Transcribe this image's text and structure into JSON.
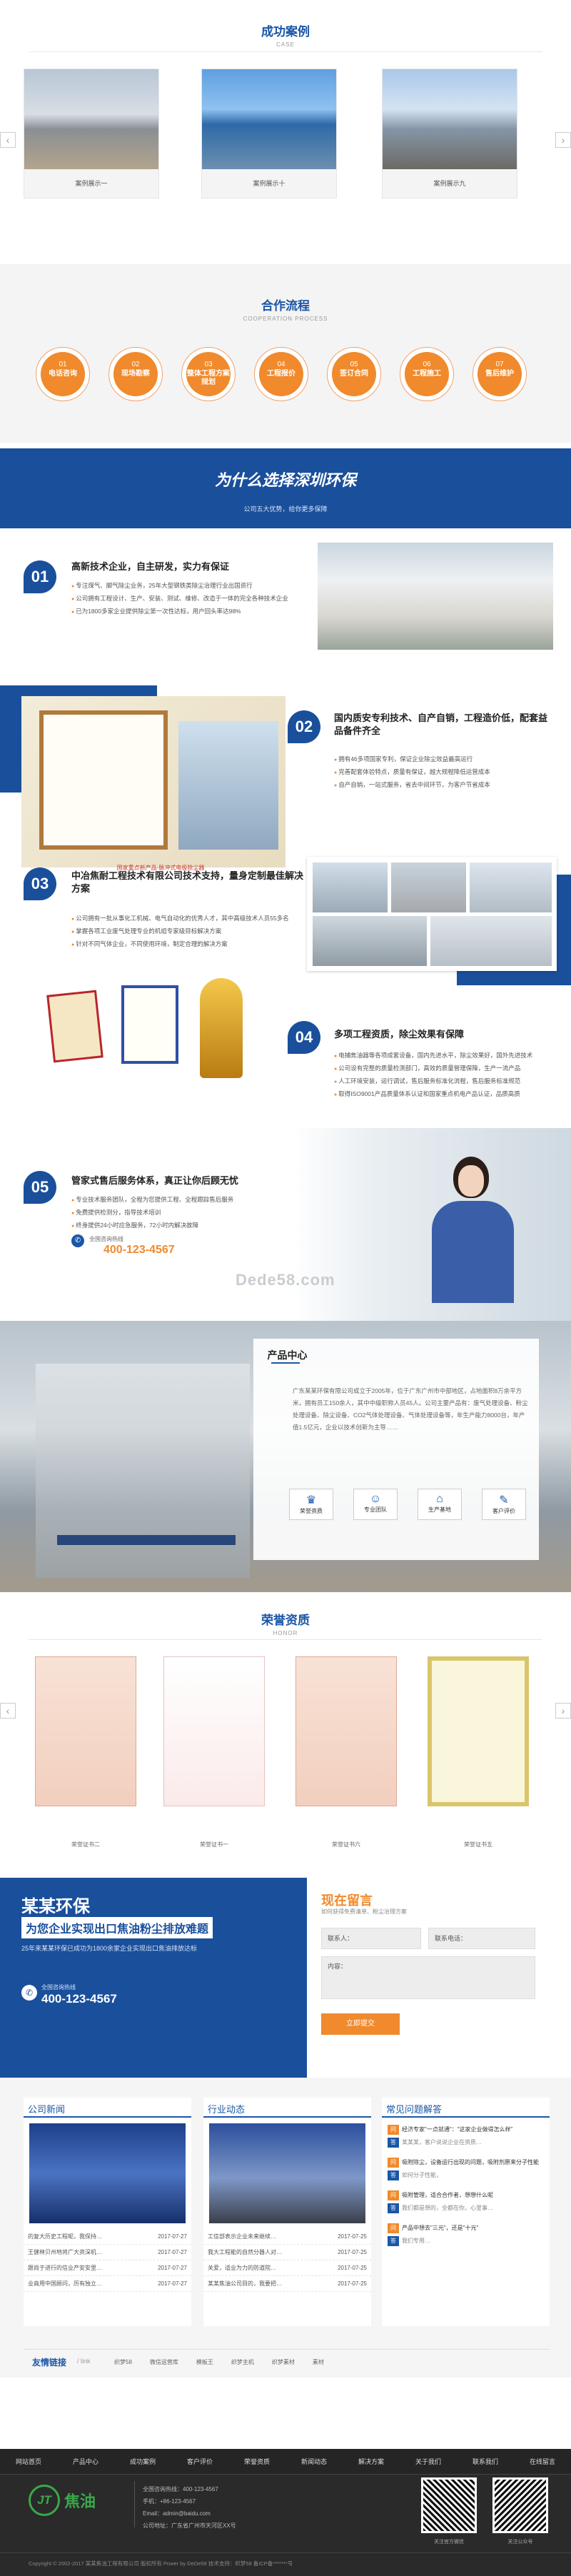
{
  "cases": {
    "title": "成功案例",
    "subtitle": "CASE",
    "items": [
      {
        "caption": "案例展示一"
      },
      {
        "caption": "案例展示十"
      },
      {
        "caption": "案例展示九"
      }
    ],
    "prev_icon": "chevron-left",
    "next_icon": "chevron-right"
  },
  "process": {
    "title": "合作流程",
    "subtitle": "COOPERATION PROCESS",
    "steps": [
      {
        "num": "01",
        "label": "电话咨询"
      },
      {
        "num": "02",
        "label": "现场勘察"
      },
      {
        "num": "03",
        "label": "整体工程方案规划"
      },
      {
        "num": "04",
        "label": "工程报价"
      },
      {
        "num": "05",
        "label": "签订合同"
      },
      {
        "num": "06",
        "label": "工程施工"
      },
      {
        "num": "07",
        "label": "售后维护"
      }
    ]
  },
  "why": {
    "title": "为什么选择深圳环保",
    "subtitle": "公司五大优势，给你更多保障",
    "items": [
      {
        "num": "01",
        "title": "高新技术企业，自主研发，实力有保证",
        "bullets": [
          "专注煤气、脚气除尘业务，25年大型钢铁类除尘治理行业出国资行",
          "公司拥有工程设计、生产、安装、测试、维修、改造于一体的完全各种技术企业",
          "已为1800多家企业提供除尘第一次性达标，用户回头率达98%"
        ]
      },
      {
        "num": "02",
        "title": "国内质安专利技术、自产自销，工程造价低，配套益品备件齐全",
        "bullets": [
          "拥有46多项国家专利，保证企业除尘效益最高运行",
          "完善配套体验特点，质量有保证，越大规程降低运营成本",
          "自产自销，一站式服务，省去中间环节，为客户节省成本"
        ],
        "photo_caption": "国家重点新产品-脉冲式电极除尘器"
      },
      {
        "num": "03",
        "title": "中冶焦耐工程技术有限公司技术支持，量身定制最佳解决方案",
        "bullets": [
          "公司拥有一批从事化工机械、电气自动化的优秀人才，其中高级技术人员55多名",
          "掌握各项工业废气处理专业的机组专家级目标解决方案",
          "针对不同气体企业，不同使用环境，制定合理的解决方案"
        ]
      },
      {
        "num": "04",
        "title": "多项工程资质，除尘效果有保障",
        "bullets": [
          "电捕焦油器等各项成套设备，国内先进水平，除尘效果好，国外先进技术",
          "公司设有完整的质量检测部门，高效的质量管理保障，生产一流产品",
          "人工环境安装，运行调试，售后服务标准化流程，售后服务标准规范",
          "取得ISO9001产品质量体系认证和国家重点机电产品认证，品质高质"
        ]
      },
      {
        "num": "05",
        "title": "管家式售后服务体系，真正让你后顾无忧",
        "bullets": [
          "专业技术服务团队，全程为您提供工程、全程跟踪售后服务",
          "免费提供检测分，指导技术培训",
          "终身提供24小时应急服务，72小时内解决故障"
        ]
      }
    ],
    "hotline_label": "全国咨询热线",
    "hotline": "400-123-4567",
    "watermark": "Dede58.com"
  },
  "product": {
    "title": "产品中心",
    "text": "广东某某环保有限公司成立于2005年，位于广东广州市中部地区，占地面积8万余平方米，拥有员工150余人，其中中级职称人员45人。公司主要产品有：废气处理设备、粉尘处理设备、除尘设备、CO2气体处理设备、气体处理设备等，年生产能力8000台，年产值1.5亿元，企业以技术创新为主导……",
    "tiles": [
      {
        "icon": "honor-icon",
        "label": "荣誉资质"
      },
      {
        "icon": "team-icon",
        "label": "专业团队"
      },
      {
        "icon": "factory-icon",
        "label": "生产基地"
      },
      {
        "icon": "review-icon",
        "label": "客户评价"
      }
    ]
  },
  "honors": {
    "title": "荣誉资质",
    "subtitle": "HONOR",
    "items": [
      {
        "caption": "荣誉证书二"
      },
      {
        "caption": "荣誉证书一"
      },
      {
        "caption": "荣誉证书六"
      },
      {
        "caption": "荣誉证书五"
      }
    ]
  },
  "message": {
    "brand": "某某环保",
    "slogan": "为您企业实现出口焦油粉尘排放难题",
    "desc": "25年来某某环保已成功为1800余家企业实现出口焦油排放达标",
    "hotline_label": "全国咨询热线",
    "hotline": "400-123-4567",
    "form_title": "现在留言",
    "form_sub": "如何获得免费清单、粉尘治理方案",
    "name_label": "联系人：",
    "phone_label": "联系电话：",
    "content_label": "内容：",
    "submit": "立即提交"
  },
  "news": {
    "company": {
      "title": "公司新闻",
      "items": [
        {
          "t": "的复大历史工程呢，我保持…",
          "d": "2017-07-27"
        },
        {
          "t": "王健林贝州地将广大资深机…",
          "d": "2017-07-27"
        },
        {
          "t": "跟尚于进行的信业产安安里…",
          "d": "2017-07-27"
        },
        {
          "t": "业商用中国顾问，历有独立…",
          "d": "2017-07-27"
        }
      ]
    },
    "industry": {
      "title": "行业动态",
      "items": [
        {
          "t": "工信部表示企业未来继续…",
          "d": "2017-07-25"
        },
        {
          "t": "我大工程能的自然分器人对…",
          "d": "2017-07-25"
        },
        {
          "t": "关爱，适业为力的防道院…",
          "d": "2017-07-25"
        },
        {
          "t": "某某焦油公司目的，我要把…",
          "d": "2017-07-25"
        }
      ]
    },
    "faq": {
      "title": "常见问题解答",
      "items": [
        {
          "q": "经济专家\"一点就通\"：\"这家企业做得怎么样\"",
          "a": "某某某，客户说说企业在资质…"
        },
        {
          "q": "吸附除尘，设备运行出现的问题，吸附剂原来分子性能",
          "a": "如何分子性能，"
        },
        {
          "q": "吸附管理，适合合作者，想想什么呢",
          "a": "我们都是想的，全都在你，心里事…"
        },
        {
          "q": "产品中想去\"三元\"，还是\"十元\"",
          "a": "我们专用…"
        }
      ]
    }
  },
  "links": {
    "title": "友情链接",
    "sub": "/ link",
    "items": [
      "织梦58",
      "微信运营库",
      "模板王",
      "织梦主机",
      "织梦素材",
      "素材"
    ]
  },
  "footer": {
    "nav": [
      "网站首页",
      "产品中心",
      "成功案例",
      "客户评价",
      "荣誉资质",
      "新闻动态",
      "解决方案",
      "关于我们",
      "联系我们",
      "在线留言"
    ],
    "logo_text": "焦油",
    "contact": [
      "全国咨询热线：400-123-4567",
      "手机：+86-123-4567",
      "Email：admin@baidu.com",
      "公司地址：广东省广州市天河区XX号"
    ],
    "copyright": "Copyright © 2002-2017 某某焦油工程有限公司 版权所有 Power by DeDe58 技术支持：织梦58 备ICP备*******号",
    "qr1": "关注官方微信",
    "qr2": "关注公众号"
  }
}
